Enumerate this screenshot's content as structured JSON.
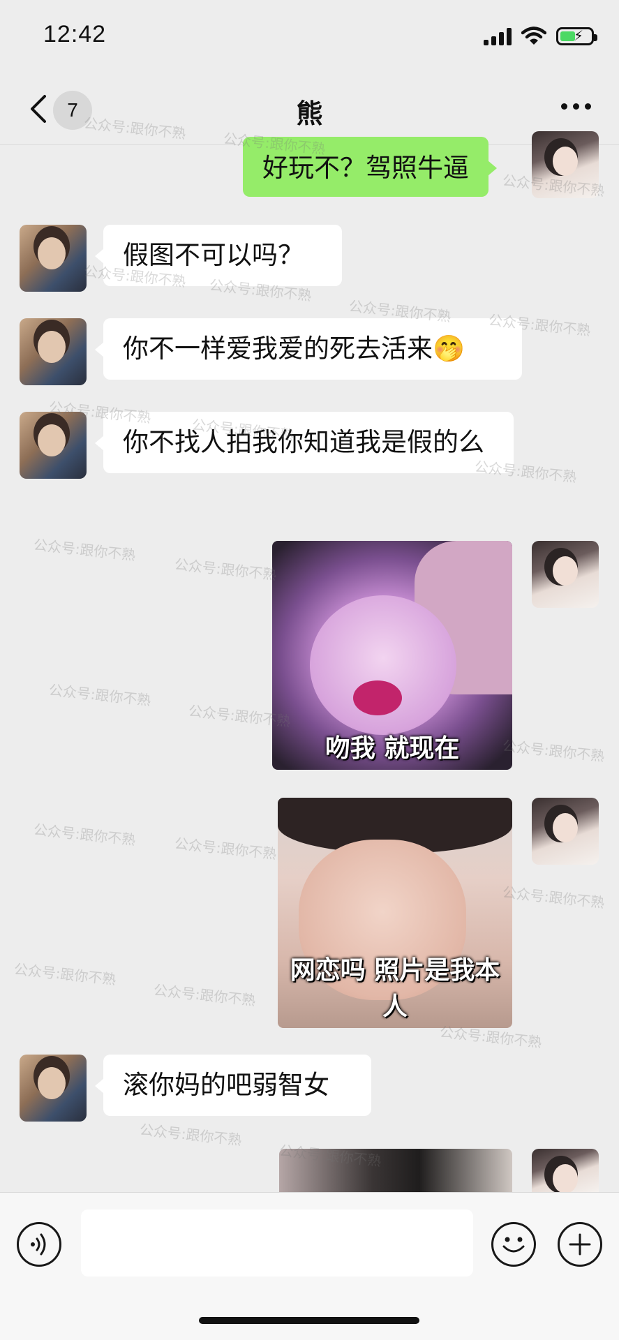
{
  "status_bar": {
    "time": "12:42",
    "battery_level": 0.5,
    "charging": true
  },
  "nav": {
    "unread_count": "7",
    "title": "熊"
  },
  "messages": [
    {
      "type": "text",
      "from": "me",
      "text": "好玩不？驾照牛逼"
    },
    {
      "type": "text",
      "from": "him",
      "text": "假图不可以吗？"
    },
    {
      "type": "text",
      "from": "him",
      "text": "你不一样爱我爱的死去活来🤭"
    },
    {
      "type": "text",
      "from": "him",
      "text": "你不找人拍我你知道我是假的么"
    },
    {
      "type": "image",
      "from": "me",
      "caption": "吻我 就现在"
    },
    {
      "type": "image",
      "from": "me",
      "caption": "网恋吗 照片是我本人"
    },
    {
      "type": "text",
      "from": "him",
      "text": "滚你妈的吧弱智女"
    },
    {
      "type": "image",
      "from": "me",
      "caption": ""
    }
  ],
  "watermark_text": "公众号:跟你不熟",
  "input": {
    "value": "",
    "placeholder": ""
  },
  "icons": {
    "back": "chevron-left-icon",
    "more": "more-dots-icon",
    "voice": "voice-icon",
    "emoji": "emoji-icon",
    "plus": "plus-icon"
  },
  "colors": {
    "background": "#ededed",
    "bubble_out": "#95ec69",
    "bubble_in": "#ffffff",
    "battery": "#4cd964"
  }
}
